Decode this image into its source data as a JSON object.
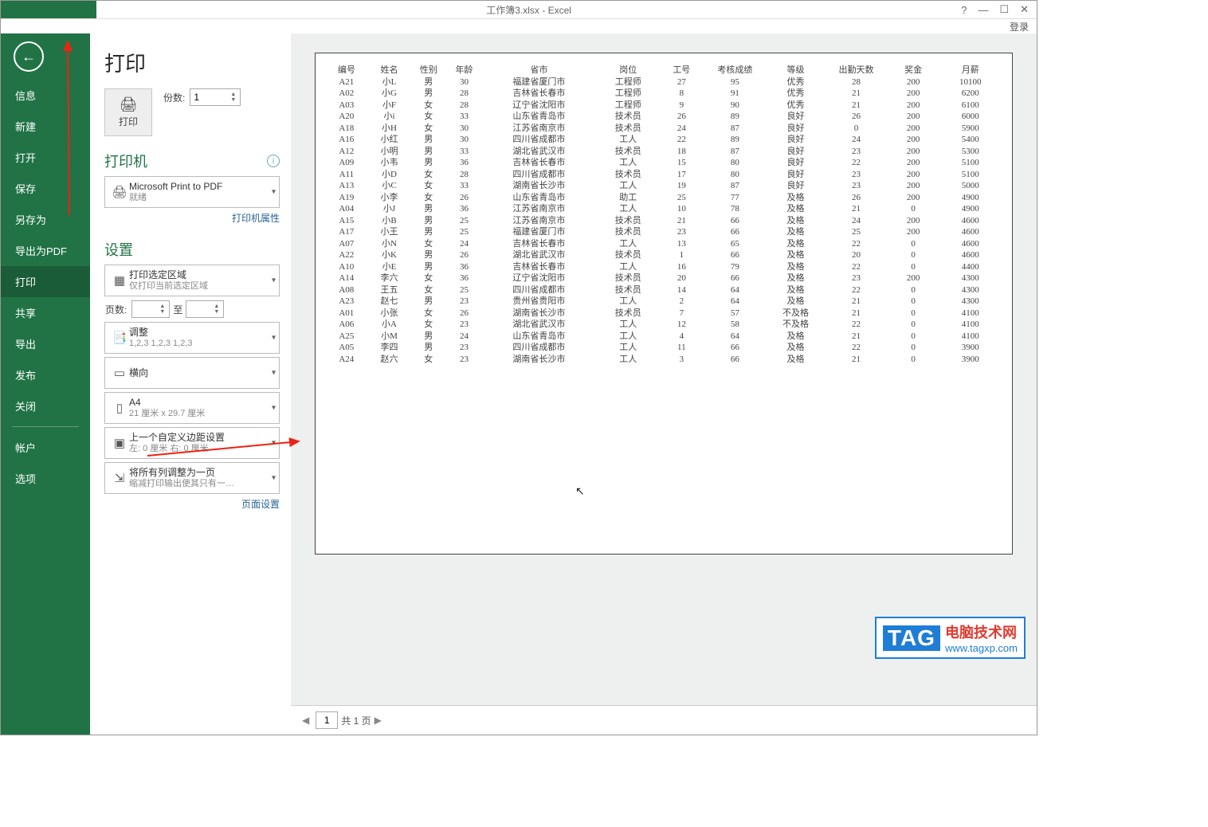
{
  "window": {
    "title": "工作簿3.xlsx - Excel",
    "help": "?",
    "min": "—",
    "max": "☐",
    "close": "✕",
    "login": "登录"
  },
  "sidebar": {
    "back_icon": "←",
    "items": [
      "信息",
      "新建",
      "打开",
      "保存",
      "另存为",
      "导出为PDF",
      "打印",
      "共享",
      "导出",
      "发布",
      "关闭"
    ],
    "bottom": [
      "帐户",
      "选项"
    ],
    "selected_index": 6
  },
  "print": {
    "title": "打印",
    "button_label": "打印",
    "copies_label": "份数:",
    "copies_value": "1"
  },
  "printer": {
    "section": "打印机",
    "name": "Microsoft Print to PDF",
    "status": "就绪",
    "props_link": "打印机属性"
  },
  "settings": {
    "section": "设置",
    "area": {
      "main": "打印选定区域",
      "sub": "仅打印当前选定区域"
    },
    "pages": {
      "label": "页数:",
      "from": "",
      "to_label": "至",
      "to": ""
    },
    "collate": {
      "main": "调整",
      "sub": "1,2,3    1,2,3    1,2,3"
    },
    "orientation": {
      "main": "横向"
    },
    "paper": {
      "main": "A4",
      "sub": "21 厘米 x 29.7 厘米"
    },
    "margins": {
      "main": "上一个自定义边距设置",
      "sub": "左: 0 厘米  右: 0 厘米"
    },
    "scaling": {
      "main": "将所有列调整为一页",
      "sub": "缩减打印输出使其只有一…"
    },
    "page_setup_link": "页面设置"
  },
  "nav": {
    "prev": "◀",
    "page": "1",
    "total_label": "共 1 页",
    "next": "▶"
  },
  "watermark": {
    "tag": "TAG",
    "line1": "电脑技术网",
    "line2": "www.tagxp.com"
  },
  "chart_data": {
    "type": "table",
    "headers": [
      "编号",
      "姓名",
      "性别",
      "年龄",
      "省市",
      "岗位",
      "工号",
      "考核成绩",
      "等级",
      "出勤天数",
      "奖金",
      "月薪"
    ],
    "rows": [
      [
        "A21",
        "小L",
        "男",
        "30",
        "福建省厦门市",
        "工程师",
        "27",
        "95",
        "优秀",
        "28",
        "200",
        "10100"
      ],
      [
        "A02",
        "小G",
        "男",
        "28",
        "吉林省长春市",
        "工程师",
        "8",
        "91",
        "优秀",
        "21",
        "200",
        "6200"
      ],
      [
        "A03",
        "小F",
        "女",
        "28",
        "辽宁省沈阳市",
        "工程师",
        "9",
        "90",
        "优秀",
        "21",
        "200",
        "6100"
      ],
      [
        "A20",
        "小i",
        "女",
        "33",
        "山东省青岛市",
        "技术员",
        "26",
        "89",
        "良好",
        "26",
        "200",
        "6000"
      ],
      [
        "A18",
        "小H",
        "女",
        "30",
        "江苏省南京市",
        "技术员",
        "24",
        "87",
        "良好",
        "0",
        "200",
        "5900"
      ],
      [
        "A16",
        "小红",
        "男",
        "30",
        "四川省成都市",
        "工人",
        "22",
        "89",
        "良好",
        "24",
        "200",
        "5400"
      ],
      [
        "A12",
        "小明",
        "男",
        "33",
        "湖北省武汉市",
        "技术员",
        "18",
        "87",
        "良好",
        "23",
        "200",
        "5300"
      ],
      [
        "A09",
        "小韦",
        "男",
        "36",
        "吉林省长春市",
        "工人",
        "15",
        "80",
        "良好",
        "22",
        "200",
        "5100"
      ],
      [
        "A11",
        "小D",
        "女",
        "28",
        "四川省成都市",
        "技术员",
        "17",
        "80",
        "良好",
        "23",
        "200",
        "5100"
      ],
      [
        "A13",
        "小C",
        "女",
        "33",
        "湖南省长沙市",
        "工人",
        "19",
        "87",
        "良好",
        "23",
        "200",
        "5000"
      ],
      [
        "A19",
        "小李",
        "女",
        "26",
        "山东省青岛市",
        "助工",
        "25",
        "77",
        "及格",
        "26",
        "200",
        "4900"
      ],
      [
        "A04",
        "小J",
        "男",
        "36",
        "江苏省南京市",
        "工人",
        "10",
        "78",
        "及格",
        "21",
        "0",
        "4900"
      ],
      [
        "A15",
        "小B",
        "男",
        "25",
        "江苏省南京市",
        "技术员",
        "21",
        "66",
        "及格",
        "24",
        "200",
        "4600"
      ],
      [
        "A17",
        "小王",
        "男",
        "25",
        "福建省厦门市",
        "技术员",
        "23",
        "66",
        "及格",
        "25",
        "200",
        "4600"
      ],
      [
        "A07",
        "小N",
        "女",
        "24",
        "吉林省长春市",
        "工人",
        "13",
        "65",
        "及格",
        "22",
        "0",
        "4600"
      ],
      [
        "A22",
        "小K",
        "男",
        "26",
        "湖北省武汉市",
        "技术员",
        "1",
        "66",
        "及格",
        "20",
        "0",
        "4600"
      ],
      [
        "A10",
        "小E",
        "男",
        "36",
        "吉林省长春市",
        "工人",
        "16",
        "79",
        "及格",
        "22",
        "0",
        "4400"
      ],
      [
        "A14",
        "李六",
        "女",
        "36",
        "辽宁省沈阳市",
        "技术员",
        "20",
        "66",
        "及格",
        "23",
        "200",
        "4300"
      ],
      [
        "A08",
        "王五",
        "女",
        "25",
        "四川省成都市",
        "技术员",
        "14",
        "64",
        "及格",
        "22",
        "0",
        "4300"
      ],
      [
        "A23",
        "赵七",
        "男",
        "23",
        "贵州省贵阳市",
        "工人",
        "2",
        "64",
        "及格",
        "21",
        "0",
        "4300"
      ],
      [
        "A01",
        "小张",
        "女",
        "26",
        "湖南省长沙市",
        "技术员",
        "7",
        "57",
        "不及格",
        "21",
        "0",
        "4100"
      ],
      [
        "A06",
        "小A",
        "女",
        "23",
        "湖北省武汉市",
        "工人",
        "12",
        "58",
        "不及格",
        "22",
        "0",
        "4100"
      ],
      [
        "A25",
        "小M",
        "男",
        "24",
        "山东省青岛市",
        "工人",
        "4",
        "64",
        "及格",
        "21",
        "0",
        "4100"
      ],
      [
        "A05",
        "李四",
        "男",
        "23",
        "四川省成都市",
        "工人",
        "11",
        "66",
        "及格",
        "22",
        "0",
        "3900"
      ],
      [
        "A24",
        "赵六",
        "女",
        "23",
        "湖南省长沙市",
        "工人",
        "3",
        "66",
        "及格",
        "21",
        "0",
        "3900"
      ]
    ]
  }
}
